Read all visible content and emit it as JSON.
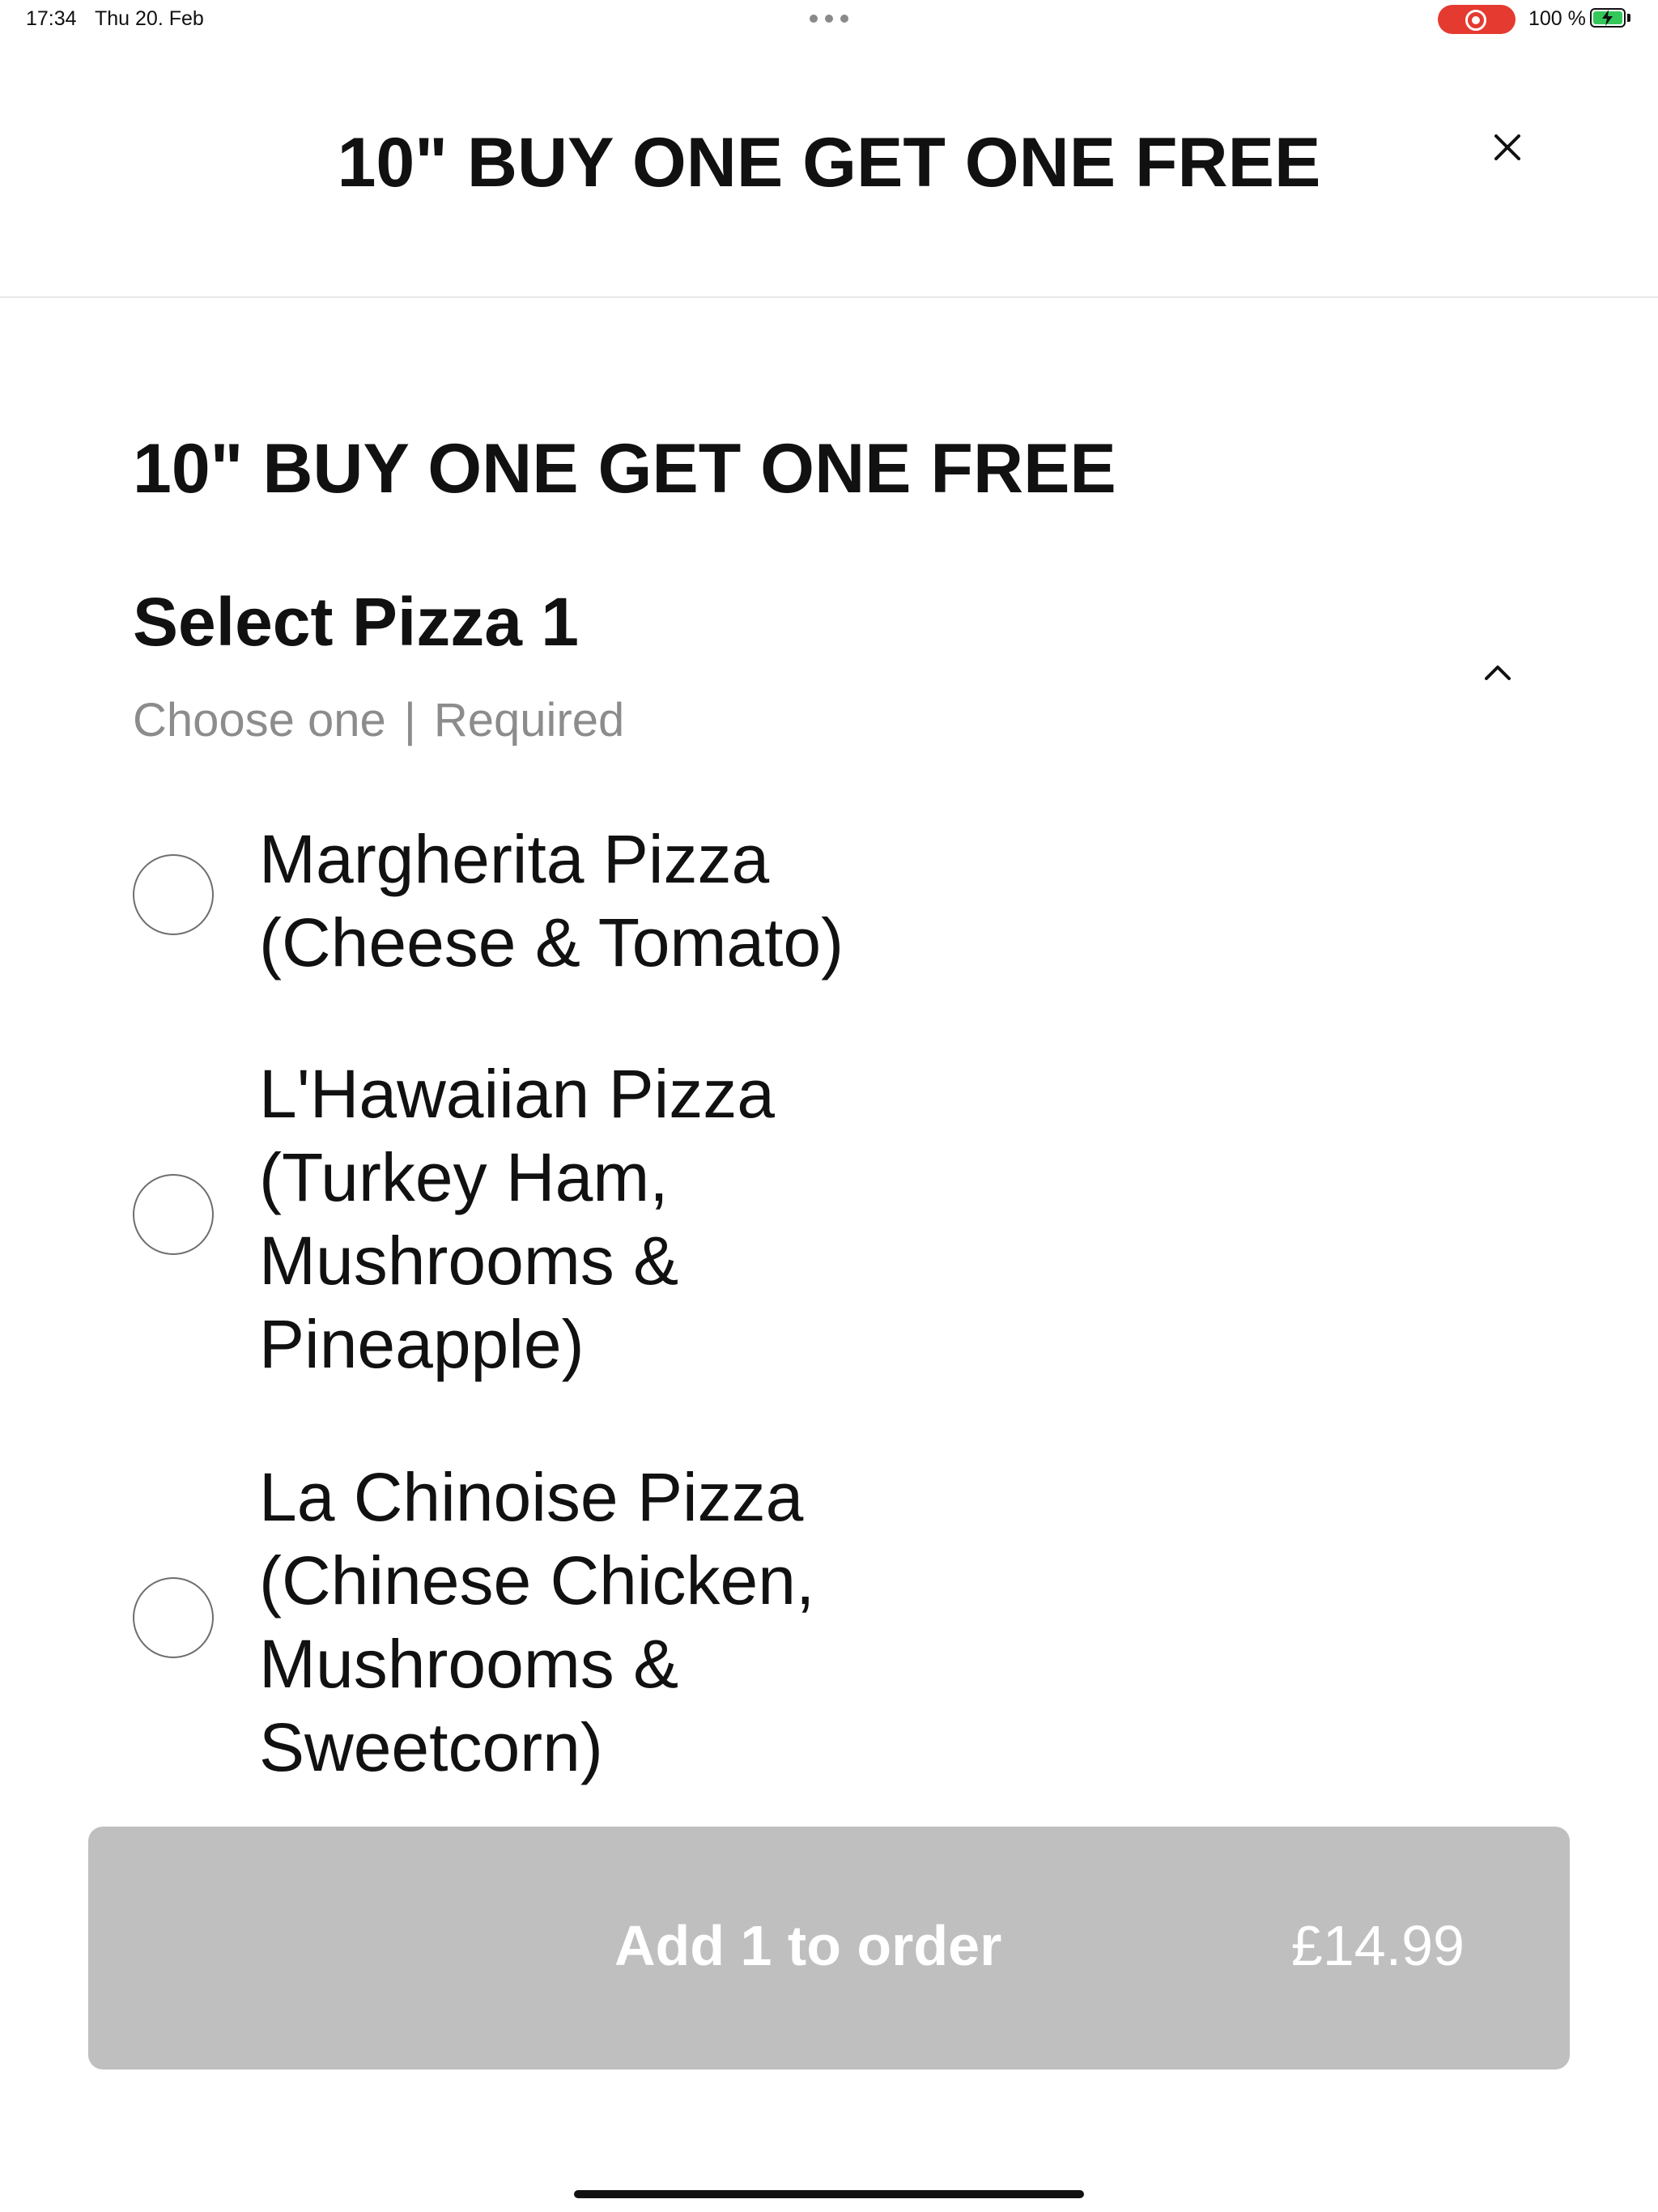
{
  "status_bar": {
    "time": "17:34",
    "date": "Thu 20. Feb",
    "battery": "100 %",
    "recording_color": "#e53a30",
    "battery_color": "#34c759"
  },
  "header": {
    "title": "10\" BUY ONE GET ONE FREE",
    "close_icon": "close-icon"
  },
  "main": {
    "section_title": "10\" BUY ONE GET ONE FREE",
    "group": {
      "title": "Select Pizza 1",
      "choose": "Choose one",
      "separator": "|",
      "required": "Required",
      "collapse_icon": "chevron-up-icon",
      "options": [
        {
          "label": "Margherita Pizza\n(Cheese & Tomato)",
          "selected": false
        },
        {
          "label": "L'Hawaiian Pizza\n(Turkey Ham,\nMushrooms &\nPineapple)",
          "selected": false
        },
        {
          "label": "La Chinoise Pizza\n(Chinese Chicken,\nMushrooms &\nSweetcorn)",
          "selected": false
        }
      ]
    }
  },
  "footer": {
    "add_label": "Add 1 to order",
    "price": "£14.99",
    "button_color": "#bfbfbf"
  }
}
